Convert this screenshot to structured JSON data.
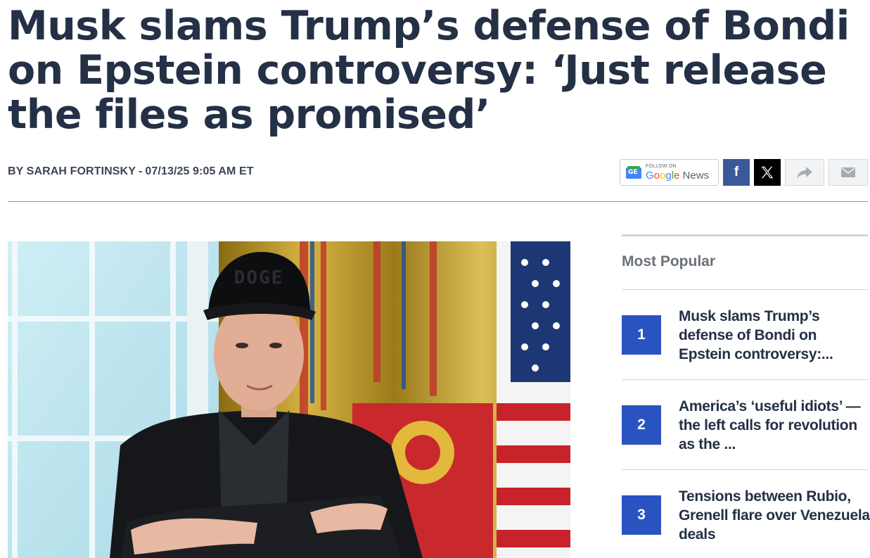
{
  "article": {
    "headline": "Musk slams Trump’s defense of Bondi on Epstein controversy: ‘Just release the files as promised’",
    "byline": {
      "author": "BY SARAH FORTINSKY",
      "separator": "-",
      "datetime": "07/13/25 9:05 AM ET"
    }
  },
  "share": {
    "google_news": {
      "follow_label": "FOLLOW ON",
      "brand_g": "G",
      "brand_o1": "o",
      "brand_o2": "o",
      "brand_g2": "g",
      "brand_l": "l",
      "brand_e": "e",
      "brand_news": " News",
      "logo_text": "GE"
    },
    "facebook_glyph": "f",
    "icons": [
      "google-news-icon",
      "facebook-icon",
      "x-icon",
      "share-arrow-icon",
      "email-icon"
    ],
    "colors": {
      "facebook": "#3b5998",
      "x": "#000000"
    }
  },
  "hero_image": {
    "cap_text": "DOGE"
  },
  "sidebar": {
    "title": "Most Popular",
    "accent": "#2a53c2",
    "items": [
      {
        "rank": "1",
        "text": "Musk slams Trump’s defense of Bondi on Epstein controversy:..."
      },
      {
        "rank": "2",
        "text": "America’s ‘useful idiots’ — the left calls for revolution as the ..."
      },
      {
        "rank": "3",
        "text": "Tensions between Rubio, Grenell flare over Venezuela deals"
      }
    ]
  }
}
